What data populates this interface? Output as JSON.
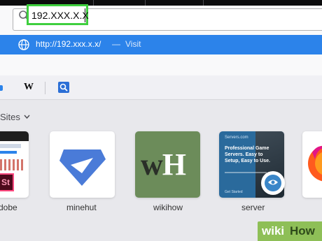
{
  "address_bar": {
    "value": "192.XXX.X.X"
  },
  "suggestion": {
    "url": "http://192.xxx.x.x/",
    "separator": "—",
    "action": "Visit"
  },
  "search_engines": {
    "wikipedia_label": "W"
  },
  "top_sites": {
    "heading": "Sites",
    "tiles": [
      {
        "label": "dobe",
        "overlay": "St"
      },
      {
        "label": "minehut"
      },
      {
        "label": "wikihow",
        "logo_w": "w",
        "logo_h": "H"
      },
      {
        "label": "server",
        "brand": "Servers.com",
        "headline": "Professional Game Servers. Easy to Setup, Easy to Use.",
        "footer": "Get Started"
      },
      {
        "label": ""
      }
    ]
  },
  "watermark": {
    "wiki": "wiki",
    "how": "How"
  },
  "colors": {
    "highlight_border": "#3ecf3e",
    "suggestion_bg": "#2c83ea",
    "minehut_blue": "#4a7bd8",
    "wikihow_green": "#6c8c5a",
    "watermark_green": "#8ebf57"
  },
  "icons": [
    "search-icon",
    "globe-icon",
    "magnifier-icon",
    "chevron-down-icon"
  ]
}
